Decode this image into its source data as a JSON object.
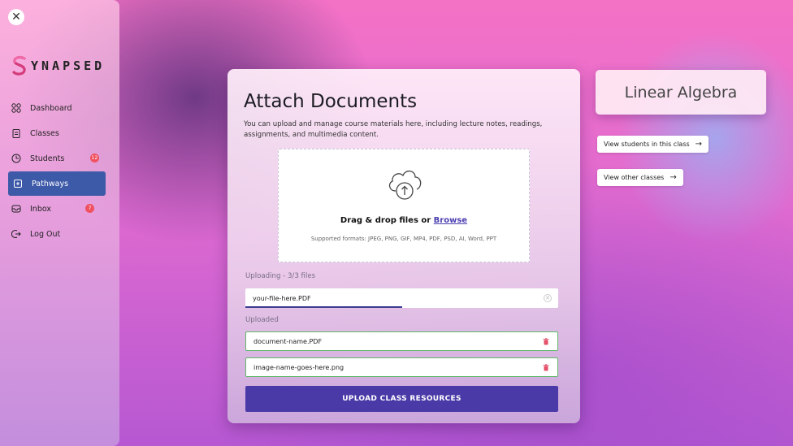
{
  "sidebar": {
    "logo_text": "YNAPSED",
    "items": [
      {
        "label": "Dashboard",
        "icon": "grid-icon"
      },
      {
        "label": "Classes",
        "icon": "clipboard-icon"
      },
      {
        "label": "Students",
        "icon": "clock-icon",
        "badge": "12"
      },
      {
        "label": "Pathways",
        "icon": "add-box-icon",
        "active": true
      },
      {
        "label": "Inbox",
        "icon": "inbox-icon",
        "badge": "7"
      },
      {
        "label": "Log Out",
        "icon": "logout-icon"
      }
    ]
  },
  "card": {
    "title": "Attach Documents",
    "description": "You can upload and manage course materials here, including lecture notes, readings, assignments, and multimedia content.",
    "dropzone": {
      "title_prefix": "Drag & drop files or ",
      "browse_label": "Browse",
      "formats": "Supported formats: JPEG, PNG, GIF, MP4, PDF, PSD, AI, Word, PPT"
    },
    "uploading_label": "Uploading - 3/3 files",
    "uploading_file": "your-file-here.PDF",
    "upload_progress": 0.5,
    "uploaded_label": "Uploaded",
    "uploaded_files": [
      "document-name.PDF",
      "image-name-goes-here.png"
    ],
    "upload_button": "UPLOAD  CLASS RESOURCES"
  },
  "right_panel": {
    "class_title": "Linear Algebra",
    "view_students": "View students in this class",
    "view_classes": "View other classes"
  },
  "colors": {
    "accent": "#4a3aa8",
    "active_nav": "#3d5aa8",
    "badge": "#f0505f",
    "uploaded_border": "#5fb86a"
  }
}
